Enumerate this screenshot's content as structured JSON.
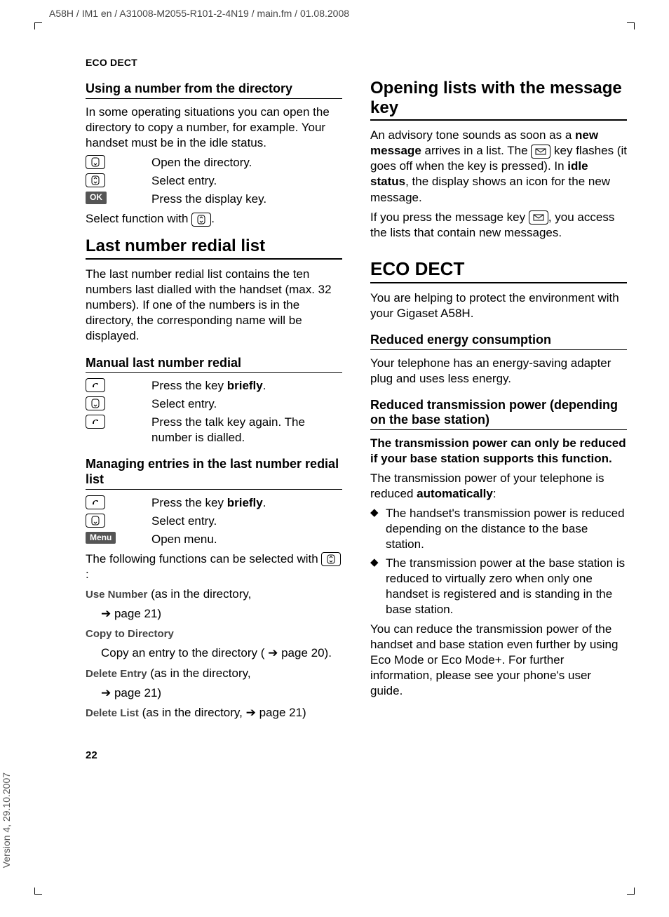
{
  "crop_path": "A58H / IM1 en / A31008-M2055-R101-2-4N19 / main.fm / 01.08.2008",
  "version": "Version 4, 29.10.2007",
  "running_head": "ECO DECT",
  "page_number": "22",
  "left": {
    "h3_1": "Using a number from the directory",
    "p1": "In some operating situations you can open the directory to copy a number, for example. Your handset must be in the idle status.",
    "step1": "Open the directory.",
    "step2": "Select entry.",
    "ok_label": "OK",
    "step3": "Press the display key.",
    "select_fn_prefix": "Select function with ",
    "select_fn_suffix": ".",
    "h2_1": "Last number redial list",
    "p2": "The last number redial list contains the ten numbers last dialled with the handset (max. 32 numbers). If one of the numbers is in the directory, the corresponding name will be displayed.",
    "h3_2": "Manual last number redial",
    "m_step1_a": "Press the key ",
    "m_step1_b": "briefly",
    "m_step1_c": ".",
    "m_step2": "Select entry.",
    "m_step3": "Press the talk key again. The number is dialled.",
    "h3_3": "Managing entries in the last number redial list",
    "g_step1_a": "Press the key ",
    "g_step1_b": "briefly",
    "g_step1_c": ".",
    "g_step2": "Select entry.",
    "menu_label": "Menu",
    "g_step3": "Open menu.",
    "g_intro_a": "The following functions can be selected with ",
    "g_intro_b": ":",
    "fn1_label": "Use Number",
    "fn1_rest": " (as in the directory,",
    "fn1_line2": " page 21)",
    "fn2_label": "Copy to Directory",
    "fn2_desc_a": "Copy an entry to the directory ( ",
    "fn2_desc_b": " page 20).",
    "fn3_label": "Delete Entry",
    "fn3_rest": " (as in the directory,",
    "fn3_line2": " page 21)",
    "fn4_label": "Delete List",
    "fn4_rest_a": " (as in the directory, ",
    "fn4_rest_b": " page 21)"
  },
  "right": {
    "h2_1": "Opening lists with the message key",
    "p1_a": "An advisory tone sounds as soon as a ",
    "p1_b": "new message",
    "p1_c": " arrives in a list. The ",
    "p1_d": " key flashes (it goes off when the key is pressed). In ",
    "p1_e": "idle status",
    "p1_f": ", the display shows an icon for the new message.",
    "p2_a": "If you press the message key ",
    "p2_b": ", you access the lists that contain new messages.",
    "h2_2": "ECO DECT",
    "p3": "You are helping to protect the environment with your Gigaset A58H.",
    "h3_1": "Reduced energy consumption",
    "p4": "Your telephone has an energy-saving adapter plug and uses less energy.",
    "h3_2": "Reduced transmission power (depending on the base station)",
    "p5": "The transmission power can only be reduced if your base station supports this function.",
    "p6_a": "The transmission power of your telephone is reduced ",
    "p6_b": "automatically",
    "p6_c": ":",
    "li1": "The handset's transmission power is reduced depending on the distance to the base station.",
    "li2": "The transmission power at the base station is reduced to virtually zero when only one handset is registered and is standing in the base station.",
    "p7": "You can reduce the transmission power of the handset and base station even further by using Eco Mode or Eco Mode+. For further information, please see your phone's user guide."
  }
}
